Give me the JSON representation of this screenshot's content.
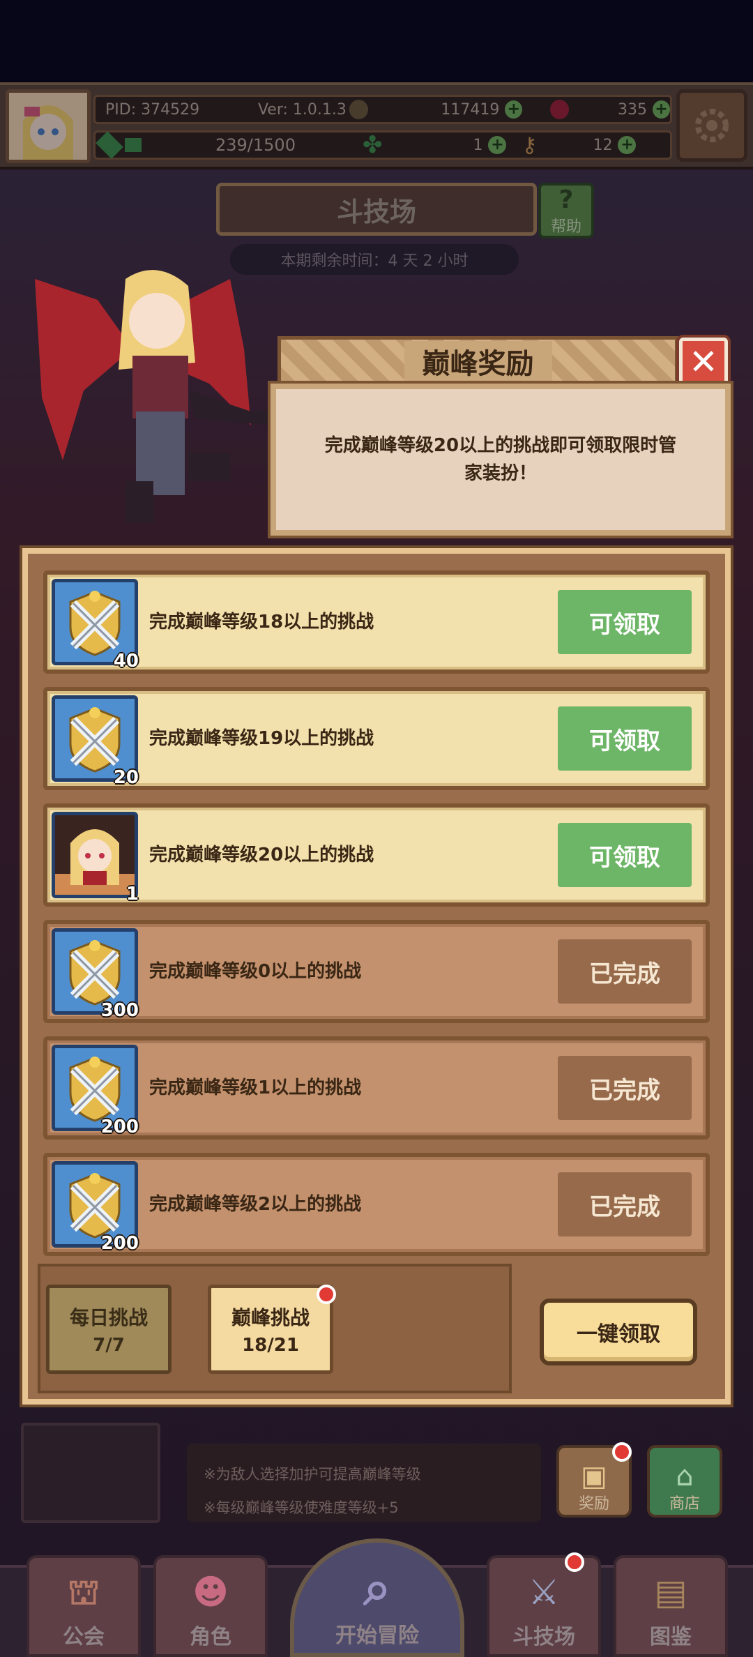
{
  "header": {
    "pid": "PID: 374529",
    "version": "Ver: 1.0.1.3",
    "gold": "117419",
    "gems": "335",
    "energy": "239/1500",
    "clover": "1",
    "keys": "12"
  },
  "arena": {
    "title": "斗技场",
    "help_label": "帮助",
    "timer": "本期剩余时间：4 天 2 小时"
  },
  "popup": {
    "title": "巅峰奖励",
    "description": "完成巅峰等级20以上的挑战即可领取限时管家装扮！"
  },
  "rewards": [
    {
      "text": "完成巅峰等级18以上的挑战",
      "count": "40",
      "button": "可领取",
      "icon": "sword-shield-icon"
    },
    {
      "text": "完成巅峰等级19以上的挑战",
      "count": "20",
      "button": "可领取",
      "icon": "sword-shield-icon"
    },
    {
      "text": "完成巅峰等级20以上的挑战",
      "count": "1",
      "button": "可领取",
      "icon": "vampire-portrait-icon"
    },
    {
      "text": "完成巅峰等级0以上的挑战",
      "count": "300",
      "button": "已完成",
      "icon": "sword-shield-icon"
    },
    {
      "text": "完成巅峰等级1以上的挑战",
      "count": "200",
      "button": "已完成",
      "icon": "sword-shield-icon"
    },
    {
      "text": "完成巅峰等级2以上的挑战",
      "count": "200",
      "button": "已完成",
      "icon": "sword-shield-icon"
    }
  ],
  "tabs": {
    "daily_label": "每日挑战",
    "daily_progress": "7/7",
    "peak_label": "巅峰挑战",
    "peak_progress": "18/21"
  },
  "claim_all": "一键领取",
  "tips": {
    "line1": "※为敌人选择加护可提高巅峰等级",
    "line2": "※每级巅峰等级使难度等级+5"
  },
  "side_buttons": {
    "reward": "奖励",
    "shop": "商店"
  },
  "nav": {
    "guild": "公会",
    "character": "角色",
    "start": "开始冒险",
    "arena": "斗技场",
    "codex": "图鉴"
  },
  "colors": {
    "claim_green": "#6db567",
    "done_brown": "#966a4b",
    "badge_red": "#e13a35"
  }
}
